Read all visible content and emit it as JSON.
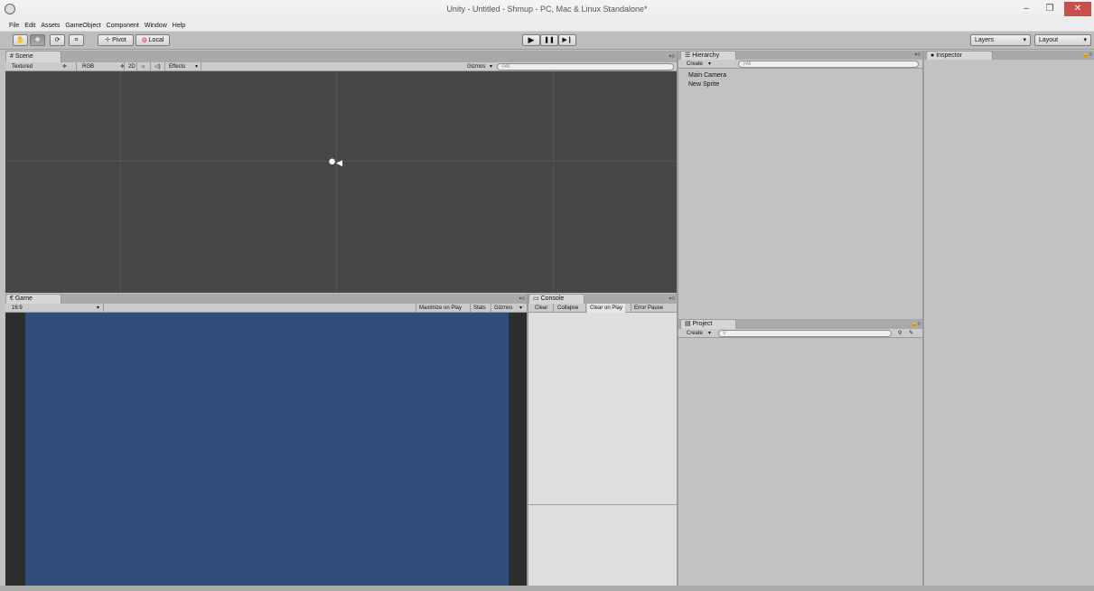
{
  "window": {
    "title": "Unity - Untitled - Shmup - PC, Mac & Linux Standalone*",
    "min_glyph": "–",
    "max_glyph": "❐",
    "close_glyph": "✕"
  },
  "menu": [
    "File",
    "Edit",
    "Assets",
    "GameObject",
    "Component",
    "Window",
    "Help"
  ],
  "toolbar": {
    "tools": [
      {
        "icon": "hand-icon",
        "glyph": "✋"
      },
      {
        "icon": "move-icon",
        "glyph": "✥"
      },
      {
        "icon": "rotate-icon",
        "glyph": "⟳"
      },
      {
        "icon": "scale-icon",
        "glyph": "⌗"
      }
    ],
    "pivot_label": "Pivot",
    "local_label": "Local",
    "play_glyph": "▶",
    "pause_glyph": "❚❚",
    "step_glyph": "▶❙",
    "layers_label": "Layers",
    "layout_label": "Layout"
  },
  "scene": {
    "tab_label": "Scene",
    "shading": "Textured",
    "render_mode": "RGB",
    "mode_2d": "2D",
    "effects": "Effects",
    "gizmos": "Gizmos",
    "search_placeholder": "All",
    "background_color": "#474747"
  },
  "game": {
    "tab_label": "Game",
    "aspect": "16:9",
    "maximize_on_play": "Maximize on Play",
    "stats": "Stats",
    "gizmos": "Gizmos",
    "background_color": "#314d79"
  },
  "console": {
    "tab_label": "Console",
    "buttons": [
      "Clear",
      "Collapse",
      "Clear on Play",
      "Error Pause"
    ]
  },
  "hierarchy": {
    "tab_label": "Hierarchy",
    "create_label": "Create",
    "search_placeholder": "All",
    "items": [
      "Main Camera",
      "New Sprite"
    ]
  },
  "project": {
    "tab_label": "Project",
    "create_label": "Create"
  },
  "inspector": {
    "tab_label": "Inspector"
  }
}
